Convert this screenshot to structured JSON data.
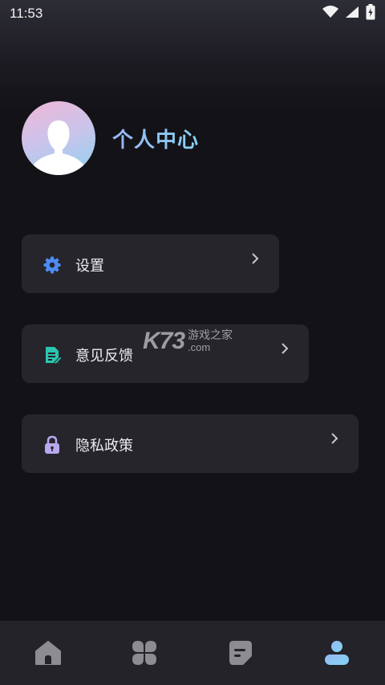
{
  "status_bar": {
    "time": "11:53",
    "icons": [
      "wifi-icon",
      "signal-icon",
      "battery-charging-icon"
    ]
  },
  "profile": {
    "title": "个人中心",
    "avatar_icon": "default-user-avatar"
  },
  "menu": [
    {
      "id": "settings",
      "label": "设置",
      "icon": "gear-icon",
      "icon_color": "#4d8cf5"
    },
    {
      "id": "feedback",
      "label": "意见反馈",
      "icon": "document-edit-icon",
      "icon_color": "#2bc6b0"
    },
    {
      "id": "privacy",
      "label": "隐私政策",
      "icon": "lock-icon",
      "icon_color": "#b9a8ee"
    }
  ],
  "watermark": {
    "logo": "K73",
    "line1": "游戏之家",
    "line2": ".com"
  },
  "bottom_nav": [
    {
      "id": "home",
      "icon": "home-icon",
      "active": false
    },
    {
      "id": "categories",
      "icon": "clover-grid-icon",
      "active": false
    },
    {
      "id": "articles",
      "icon": "note-icon",
      "active": false
    },
    {
      "id": "profile",
      "icon": "user-icon",
      "active": true
    }
  ],
  "colors": {
    "background": "#131217",
    "card": "#26252b",
    "bottom_bar": "#24232a",
    "nav_inactive": "#8d8c92",
    "accent_gradient": [
      "#9ab7f1",
      "#86d1f4"
    ]
  }
}
